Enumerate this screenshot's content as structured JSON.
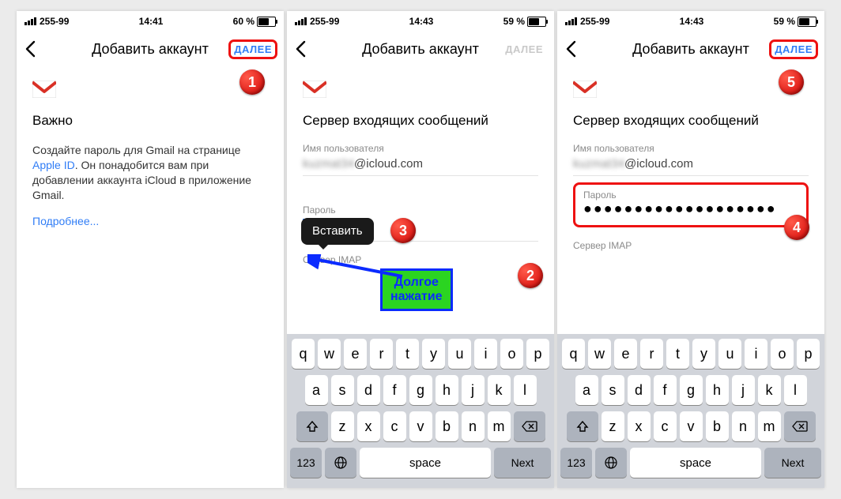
{
  "screens": {
    "s1": {
      "status": {
        "carrier": "255-99",
        "time": "14:41",
        "battery_pct": "60 %",
        "battery_fill_px": "13px"
      },
      "nav": {
        "title": "Добавить аккаунт",
        "next": "ДАЛЕЕ"
      },
      "heading": "Важно",
      "body_pre": "Создайте пароль для Gmail на странице ",
      "body_link": "Apple ID",
      "body_post": ". Он понадобится вам при добавлении аккаунта iCloud в приложение Gmail.",
      "more": "Подробнее..."
    },
    "s2": {
      "status": {
        "carrier": "255-99",
        "time": "14:43",
        "battery_pct": "59 %",
        "battery_fill_px": "13px"
      },
      "nav": {
        "title": "Добавить аккаунт",
        "next": "ДАЛЕЕ"
      },
      "heading": "Сервер входящих сообщений",
      "user_label": "Имя пользователя",
      "user_value": "@icloud.com",
      "pwd_label": "Пароль",
      "imap_label": "Сервер IMAP",
      "paste": "Вставить",
      "callout_l1": "Долгое",
      "callout_l2": "нажатие"
    },
    "s3": {
      "status": {
        "carrier": "255-99",
        "time": "14:43",
        "battery_pct": "59 %",
        "battery_fill_px": "13px"
      },
      "nav": {
        "title": "Добавить аккаунт",
        "next": "ДАЛЕЕ"
      },
      "heading": "Сервер входящих сообщений",
      "user_label": "Имя пользователя",
      "user_value_blur": "kuzmat34",
      "user_value": "@icloud.com",
      "pwd_label": "Пароль",
      "pwd_dots": "●●●●●●●●●●●●●●●●●●●",
      "imap_label": "Сервер IMAP"
    }
  },
  "keyboard": {
    "row1": [
      "q",
      "w",
      "e",
      "r",
      "t",
      "y",
      "u",
      "i",
      "o",
      "p"
    ],
    "row2": [
      "a",
      "s",
      "d",
      "f",
      "g",
      "h",
      "j",
      "k",
      "l"
    ],
    "row3": [
      "z",
      "x",
      "c",
      "v",
      "b",
      "n",
      "m"
    ],
    "k123": "123",
    "space": "space",
    "next": "Next"
  },
  "badges": {
    "b1": "1",
    "b2": "2",
    "b3": "3",
    "b4": "4",
    "b5": "5"
  }
}
